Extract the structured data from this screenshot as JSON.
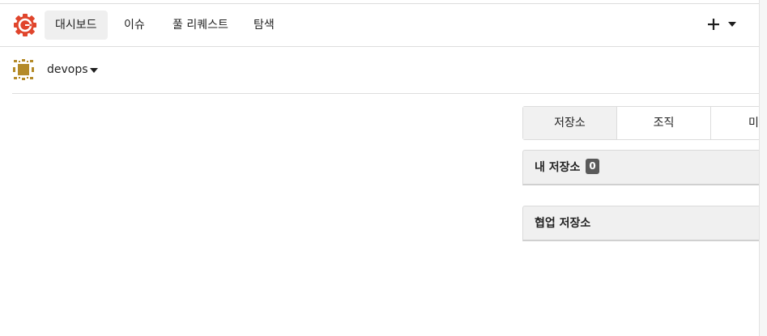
{
  "nav": {
    "items": [
      {
        "label": "대시보드",
        "active": true
      },
      {
        "label": "이슈",
        "active": false
      },
      {
        "label": "풀 리퀘스트",
        "active": false
      },
      {
        "label": "탐색",
        "active": false
      }
    ],
    "create_icon": "plus-icon",
    "create_menu_icon": "caret-down-icon"
  },
  "context": {
    "name": "devops",
    "switcher_icon": "caret-down-icon"
  },
  "tabs": [
    {
      "label": "저장소",
      "active": true
    },
    {
      "label": "조직",
      "active": false
    },
    {
      "label": "미러",
      "active": false
    }
  ],
  "my_repos": {
    "title": "내 저장소",
    "count": "0"
  },
  "collab_repos": {
    "title": "협업 저장소"
  },
  "colors": {
    "logo": "#e0452c",
    "avatar": "#b48a28",
    "badge": "#5a5a5a"
  }
}
